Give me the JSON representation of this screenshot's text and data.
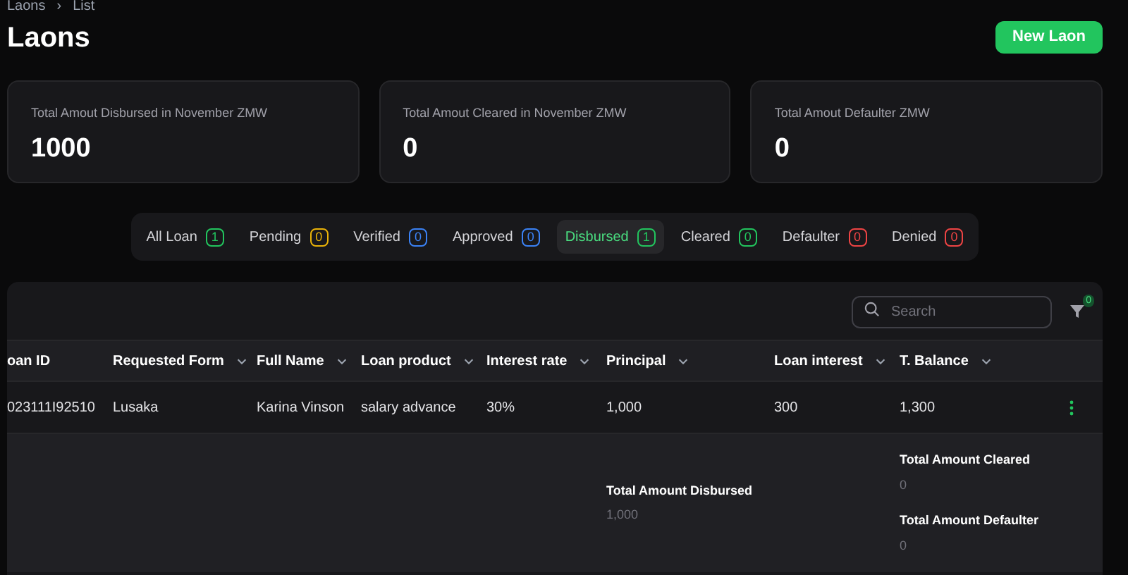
{
  "breadcrumb": [
    "Laons",
    "›",
    "List"
  ],
  "title": "Laons",
  "new_button": "New Laon",
  "stats": [
    {
      "label": "Total Amout Disbursed in November ZMW",
      "value": "1000"
    },
    {
      "label": "Total Amout Cleared in November ZMW",
      "value": "0"
    },
    {
      "label": "Total Amout Defaulter ZMW",
      "value": "0"
    }
  ],
  "tabs": [
    {
      "label": "All Loan",
      "count": "1",
      "color": "#22c55e",
      "selected": false
    },
    {
      "label": "Pending",
      "count": "0",
      "color": "#eab308",
      "selected": false
    },
    {
      "label": "Verified",
      "count": "0",
      "color": "#3b82f6",
      "selected": false
    },
    {
      "label": "Approved",
      "count": "0",
      "color": "#3b82f6",
      "selected": false
    },
    {
      "label": "Disbursed",
      "count": "1",
      "color": "#22c55e",
      "selected": true
    },
    {
      "label": "Cleared",
      "count": "0",
      "color": "#22c55e",
      "selected": false
    },
    {
      "label": "Defaulter",
      "count": "0",
      "color": "#ef4444",
      "selected": false
    },
    {
      "label": "Denied",
      "count": "0",
      "color": "#ef4444",
      "selected": false
    }
  ],
  "search": {
    "placeholder": "Search"
  },
  "filter_count": "0",
  "table": {
    "columns": [
      "oan ID",
      "Requested Form",
      "Full Name",
      "Loan product",
      "Interest rate",
      "Principal",
      "Loan interest",
      "T. Balance"
    ],
    "rows": [
      [
        "023111I92510",
        "Lusaka",
        "Karina Vinson",
        "salary advance",
        "30%",
        "1,000",
        "300",
        "1,300"
      ]
    ]
  },
  "summary": {
    "disbursed": {
      "label": "Total Amount Disbursed",
      "value": "1,000"
    },
    "cleared": {
      "label": "Total Amount Cleared",
      "value": "0"
    },
    "defaulter": {
      "label": "Total Amount Defaulter",
      "value": "0"
    }
  }
}
